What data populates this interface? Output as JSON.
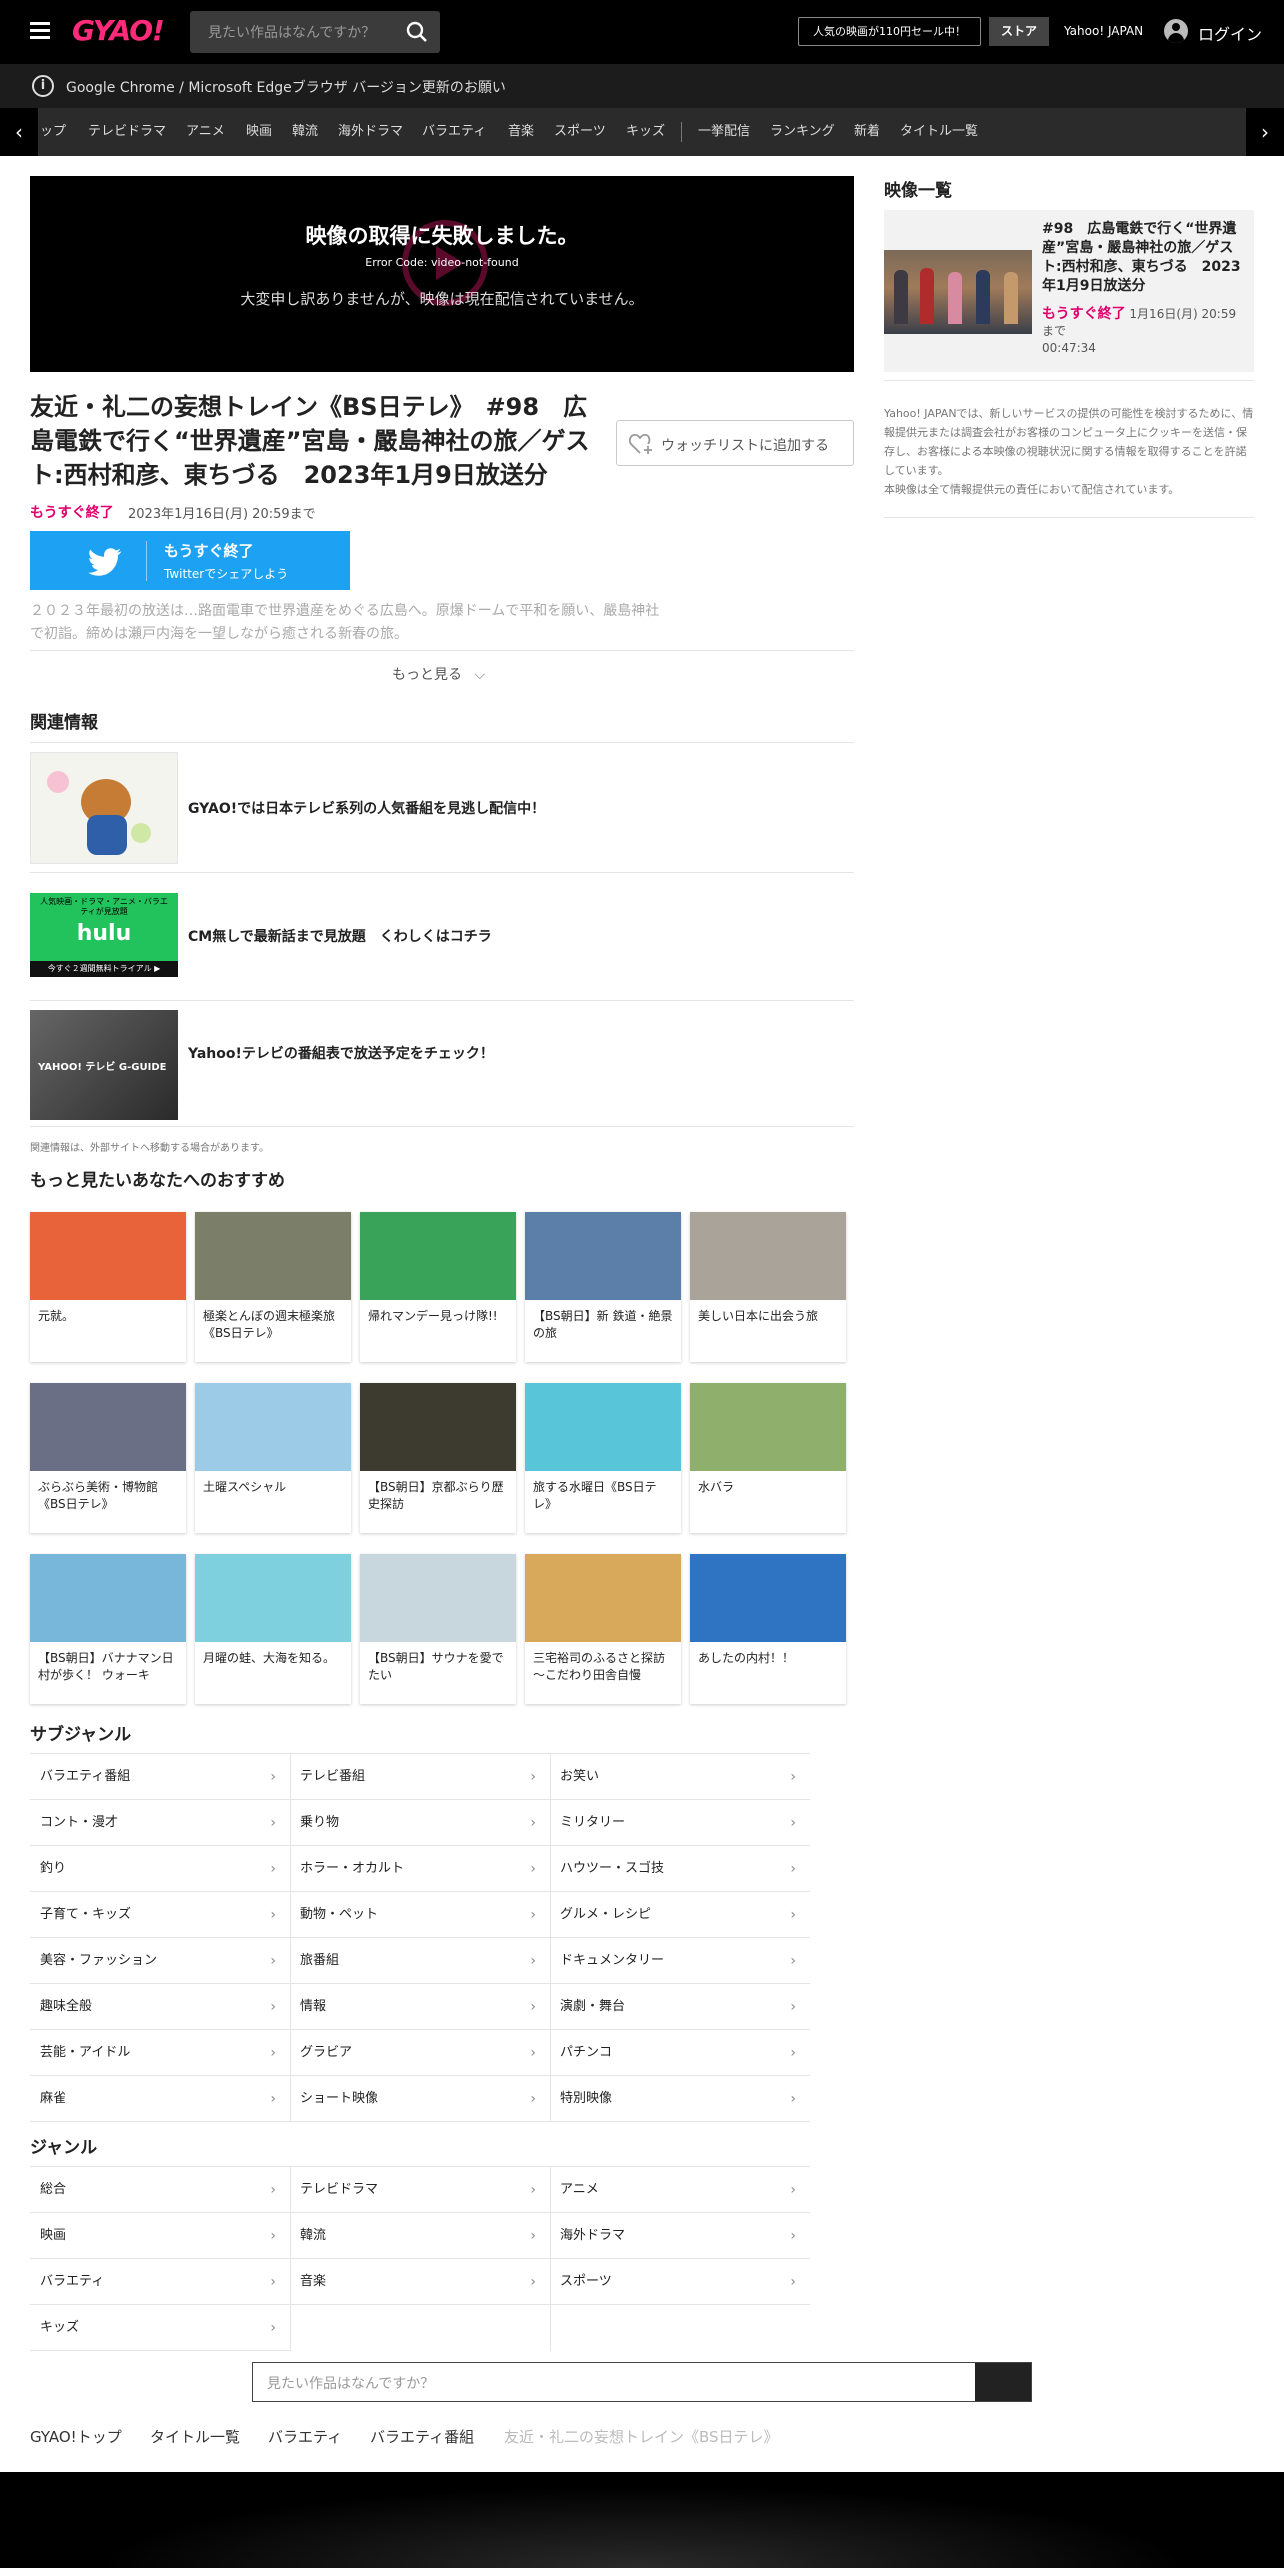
{
  "header": {
    "logo": "GYAO!",
    "search_placeholder": "見たい作品はなんですか？",
    "promo": "人気の映画が110円セール中！",
    "store": "ストア",
    "yahoo": "Yahoo! JAPAN",
    "login": "ログイン"
  },
  "notice": "Google Chrome / Microsoft Edgeブラウザ バージョン更新のお願い",
  "categories": [
    "ップ",
    "テレビドラマ",
    "アニメ",
    "映画",
    "韓流",
    "海外ドラマ",
    "バラエティ",
    "音楽",
    "スポーツ",
    "キッズ",
    "一挙配信",
    "ランキング",
    "新着",
    "タイトル一覧"
  ],
  "player": {
    "error_title": "映像の取得に失敗しました。",
    "error_code": "Error Code: video-not-found",
    "error_msg": "大変申し訳ありませんが、映像は現在配信されていません。"
  },
  "video": {
    "title": "友近・礼二の妄想トレイン《BS日テレ》　#98　広島電鉄で行く“世界遺産”宮島・嚴島神社の旅／ゲスト:西村和彦、東ちづる　2023年1月9日放送分",
    "badge": "もうすぐ終了",
    "expiry": "2023年1月16日(月) 20:59まで",
    "watchlist": "ウォッチリストに追加する",
    "twitter_line1": "もうすぐ終了",
    "twitter_line2": "Twitterでシェアしよう",
    "description": "２０２３年最初の放送は…路面電車で世界遺産をめぐる広島へ。原爆ドームで平和を願い、嚴島神社で初詣。締めは瀬戸内海を一望しながら癒される新春の旅。",
    "more": "もっと見る"
  },
  "related": {
    "heading": "関連情報",
    "items": [
      {
        "text": "GYAO!では日本テレビ系列の人気番組を見逃し配信中！"
      },
      {
        "text": "CM無しで最新話まで見放題　くわしくはコチラ",
        "thumb_text_top": "人気映画・ドラマ・アニメ・バラエティが見放題",
        "thumb_brand": "hulu",
        "thumb_text_bottom": "今すぐ２週間無料トライアル ▶"
      },
      {
        "text": "Yahoo!テレビの番組表で放送予定をチェック！",
        "thumb_text": "YAHOO! テレビ G-GUIDE"
      }
    ],
    "note": "関連情報は、外部サイトへ移動する場合があります。"
  },
  "recommend": {
    "heading": "もっと見たいあなたへのおすすめ",
    "items": [
      {
        "label": "元就。",
        "color": "#e8633a"
      },
      {
        "label": "極楽とんぼの週末極楽旅《BS日テレ》",
        "color": "#7b7f6a"
      },
      {
        "label": "帰れマンデー見っけ隊!!",
        "color": "#3aa35a"
      },
      {
        "label": "【BS朝日】新 鉄道・絶景の旅",
        "color": "#5b7fa8"
      },
      {
        "label": "美しい日本に出会う旅",
        "color": "#a9a39a"
      },
      {
        "label": "ぶらぶら美術・博物館《BS日テレ》",
        "color": "#6a6f86"
      },
      {
        "label": "土曜スペシャル",
        "color": "#9ccbe8"
      },
      {
        "label": "【BS朝日】京都ぶらり歴史探訪",
        "color": "#3d3a30"
      },
      {
        "label": "旅する水曜日《BS日テレ》",
        "color": "#59c5d8"
      },
      {
        "label": "水バラ",
        "color": "#8fb06c"
      },
      {
        "label": "【BS朝日】バナナマン日村が歩く！ ウォーキ",
        "color": "#78b7d9"
      },
      {
        "label": "月曜の蛙、大海を知る。",
        "color": "#7ed0de"
      },
      {
        "label": "【BS朝日】サウナを愛でたい",
        "color": "#c8d7de"
      },
      {
        "label": "三宅裕司のふるさと探訪～こだわり田舎自慢",
        "color": "#d8a95a"
      },
      {
        "label": "あしたの内村！！",
        "color": "#2f74c2"
      }
    ]
  },
  "subgenre": {
    "heading": "サブジャンル",
    "items": [
      "バラエティ番組",
      "テレビ番組",
      "お笑い",
      "コント・漫才",
      "乗り物",
      "ミリタリー",
      "釣り",
      "ホラー・オカルト",
      "ハウツー・スゴ技",
      "子育て・キッズ",
      "動物・ペット",
      "グルメ・レシピ",
      "美容・ファッション",
      "旅番組",
      "ドキュメンタリー",
      "趣味全般",
      "情報",
      "演劇・舞台",
      "芸能・アイドル",
      "グラビア",
      "パチンコ",
      "麻雀",
      "ショート映像",
      "特別映像"
    ]
  },
  "genre": {
    "heading": "ジャンル",
    "items": [
      "総合",
      "テレビドラマ",
      "アニメ",
      "映画",
      "韓流",
      "海外ドラマ",
      "バラエティ",
      "音楽",
      "スポーツ",
      "キッズ"
    ]
  },
  "bottom_search_placeholder": "見たい作品はなんですか？",
  "breadcrumb": [
    "GYAO!トップ",
    "タイトル一覧",
    "バラエティ",
    "バラエティ番組",
    "友近・礼二の妄想トレイン《BS日テレ》"
  ],
  "sidebar": {
    "heading": "映像一覧",
    "item_title": "#98　広島電鉄で行く“世界遺産”宮島・嚴島神社の旅／ゲスト:西村和彦、東ちづる　2023年1月9日放送分",
    "item_badge": "もうすぐ終了",
    "item_expiry": "1月16日(月) 20:59まで",
    "item_duration": "00:47:34",
    "disclaimer": "Yahoo! JAPANでは、新しいサービスの提供の可能性を検討するために、情報提供元または調査会社がお客様のコンピュータ上にクッキーを送信・保存し、お客様による本映像の視聴状況に関する情報を取得することを許諾しています。\n本映像は全て情報提供元の責任において配信されています。"
  },
  "colors": {
    "accent": "#e0006c",
    "twitter": "#1da1f2",
    "header_bg": "#000000"
  }
}
